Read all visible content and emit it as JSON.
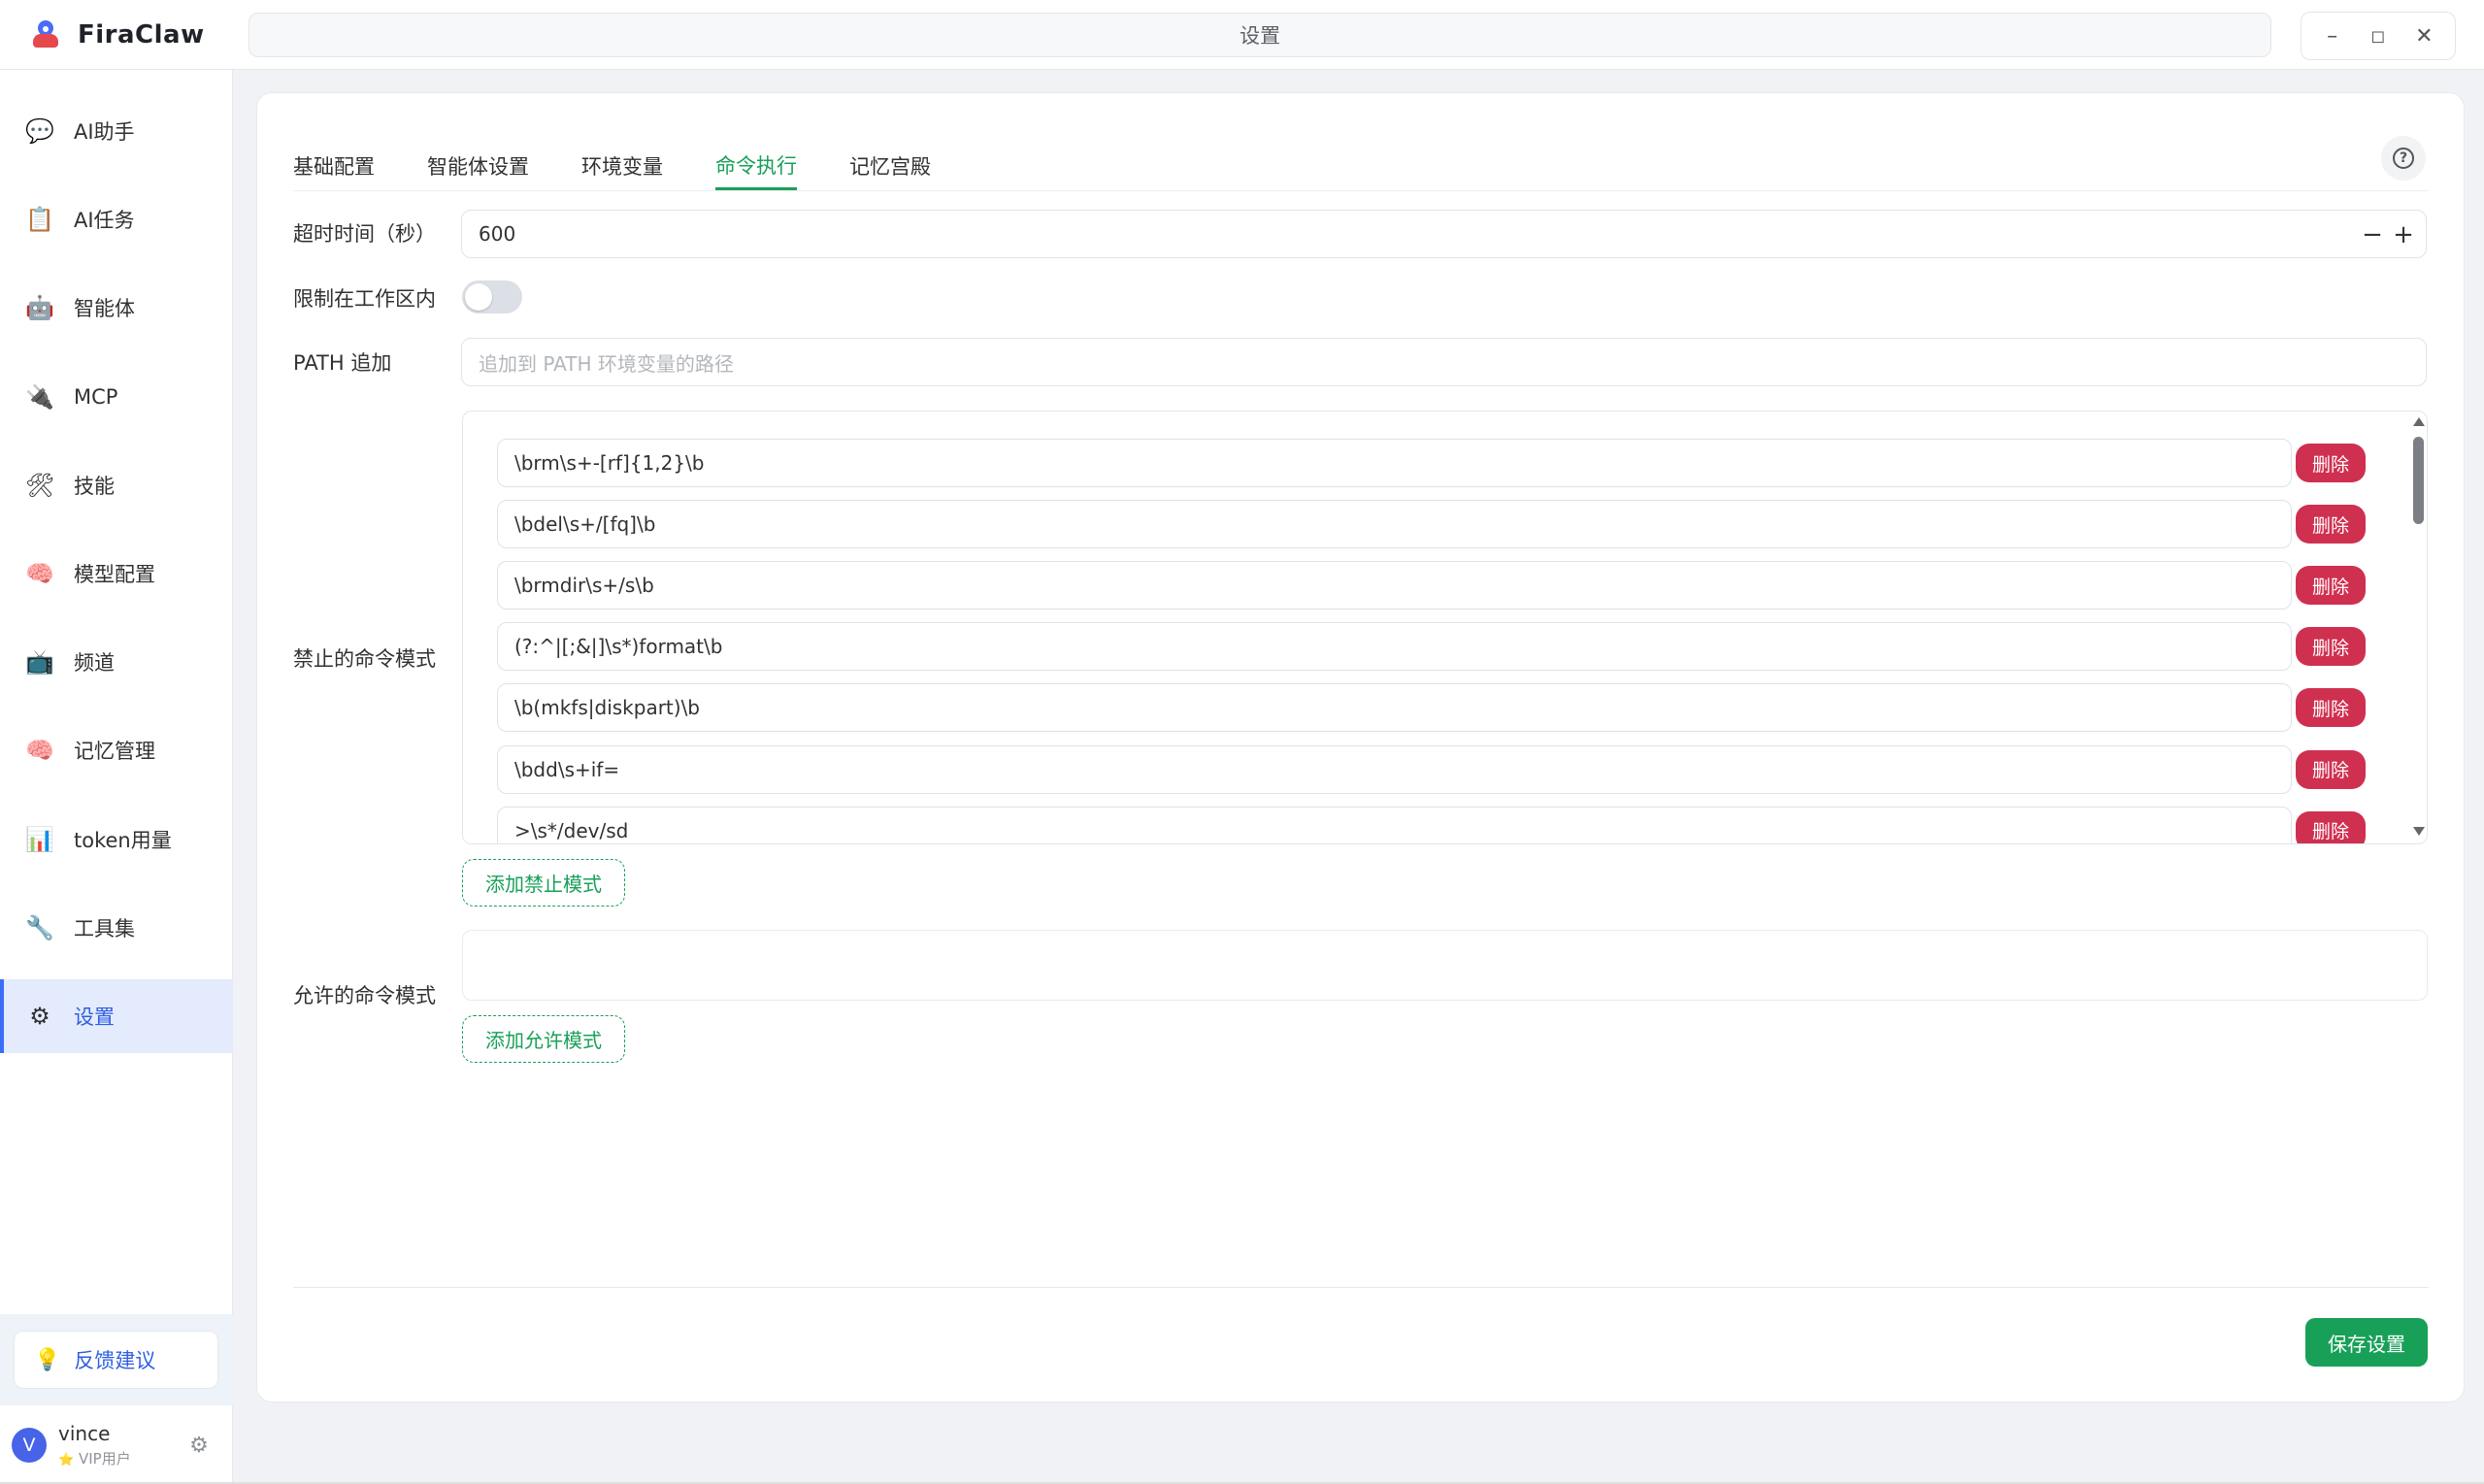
{
  "app": {
    "name": "FiraClaw",
    "window_title": "设置"
  },
  "window_controls": {
    "minimize": "–",
    "maximize": "◻",
    "close": "✕"
  },
  "sidebar": {
    "items": [
      {
        "label": "AI助手",
        "icon": "chat-bubble-icon",
        "glyph": "💬"
      },
      {
        "label": "AI任务",
        "icon": "clipboard-icon",
        "glyph": "📋"
      },
      {
        "label": "智能体",
        "icon": "robot-icon",
        "glyph": "🤖"
      },
      {
        "label": "MCP",
        "icon": "plug-icon",
        "glyph": "🔌"
      },
      {
        "label": "技能",
        "icon": "tools-icon",
        "glyph": "🛠"
      },
      {
        "label": "模型配置",
        "icon": "brain-icon",
        "glyph": "🧠"
      },
      {
        "label": "频道",
        "icon": "tv-icon",
        "glyph": "📺"
      },
      {
        "label": "记忆管理",
        "icon": "brain-icon",
        "glyph": "🧠"
      },
      {
        "label": "token用量",
        "icon": "bar-chart-icon",
        "glyph": "📊"
      },
      {
        "label": "工具集",
        "icon": "wrench-icon",
        "glyph": "🔧"
      },
      {
        "label": "设置",
        "icon": "gear-icon",
        "glyph": "⚙"
      }
    ],
    "active_index": 10,
    "feedback": {
      "label": "反馈建议",
      "glyph": "💡"
    },
    "user": {
      "initial": "V",
      "name": "vince",
      "tag": "VIP用户",
      "tag_glyph": "⭐"
    }
  },
  "tabs": [
    {
      "label": "基础配置"
    },
    {
      "label": "智能体设置"
    },
    {
      "label": "环境变量"
    },
    {
      "label": "命令执行"
    },
    {
      "label": "记忆宫殿"
    }
  ],
  "active_tab": 3,
  "form": {
    "timeout": {
      "label": "超时时间（秒）",
      "value": "600"
    },
    "restrict_workspace": {
      "label": "限制在工作区内",
      "enabled": false
    },
    "path_append": {
      "label": "PATH 追加",
      "placeholder": "追加到 PATH 环境变量的路径"
    },
    "blocked_patterns": {
      "label": "禁止的命令模式",
      "items": [
        "\\brm\\s+-[rf]{1,2}\\b",
        "\\bdel\\s+/[fq]\\b",
        "\\brmdir\\s+/s\\b",
        "(?:^|[;&|]\\s*)format\\b",
        "\\b(mkfs|diskpart)\\b",
        "\\bdd\\s+if=",
        ">\\s*/dev/sd"
      ],
      "delete_label": "删除",
      "add_label": "添加禁止模式"
    },
    "allowed_patterns": {
      "label": "允许的命令模式",
      "items": [],
      "add_label": "添加允许模式"
    }
  },
  "save_label": "保存设置",
  "colors": {
    "accent": "#18a058",
    "danger": "#d03050",
    "nav_active": "#3b6ef6"
  }
}
